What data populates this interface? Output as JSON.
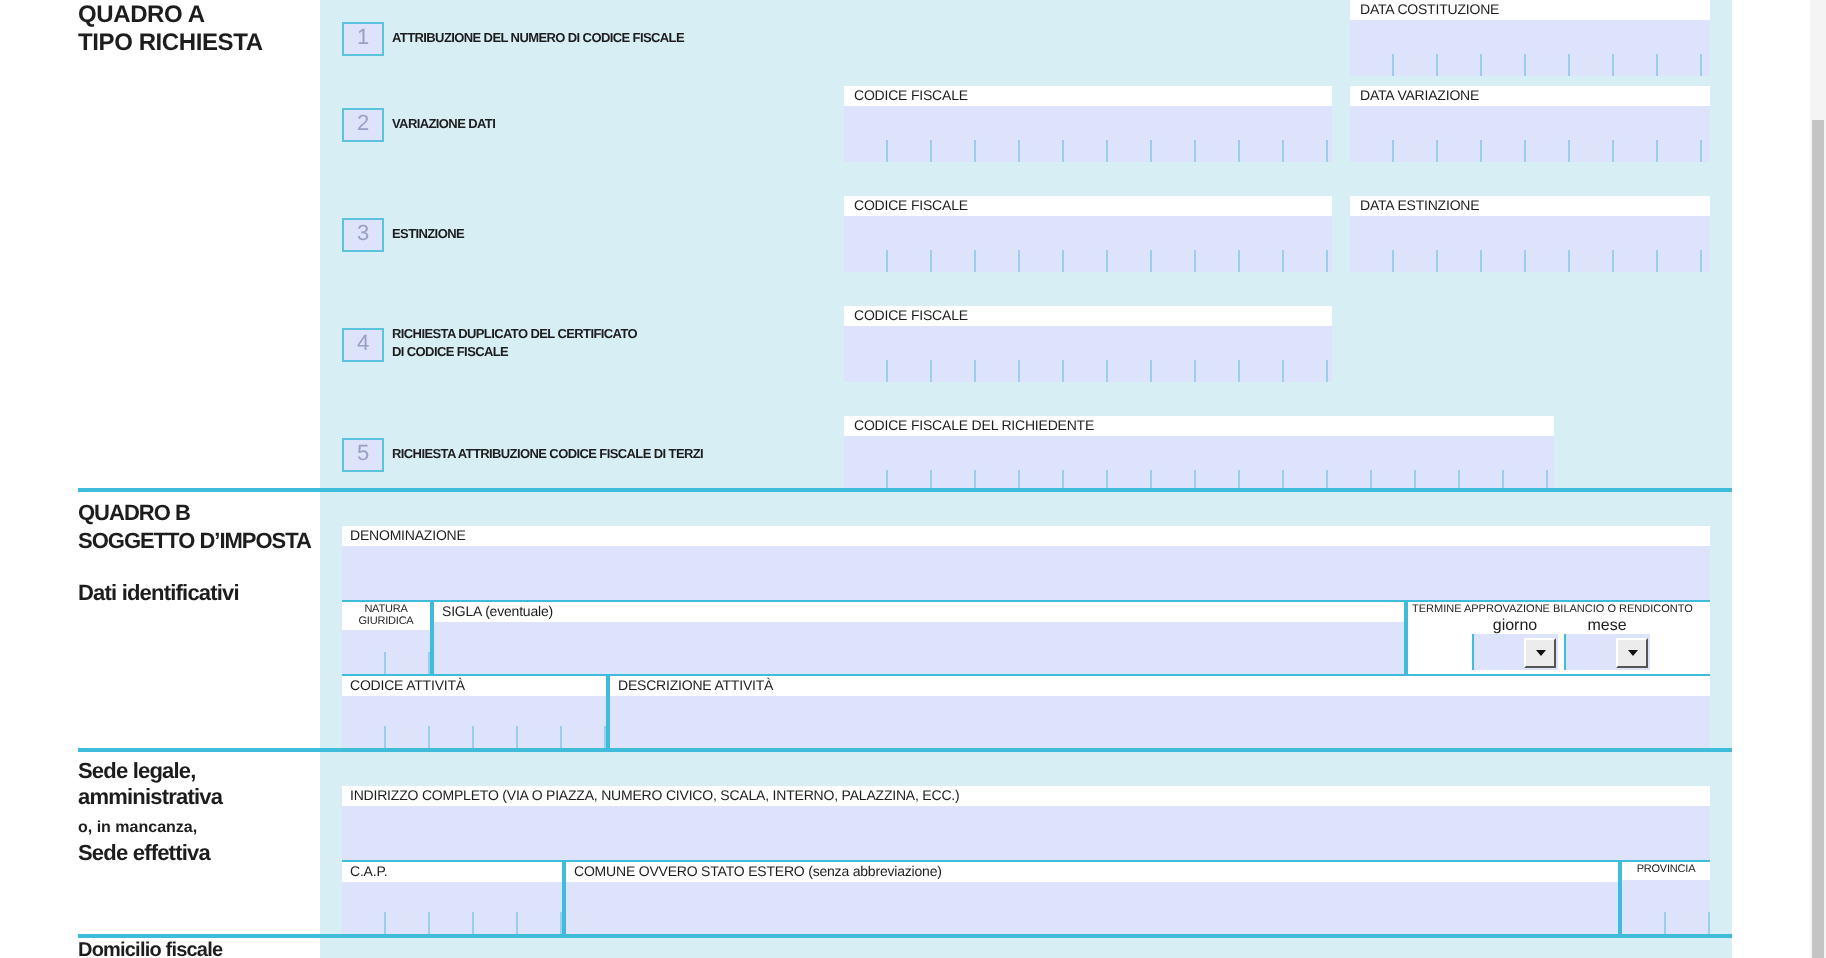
{
  "quadro_a": {
    "title": "QUADRO A",
    "subtitle": "TIPO RICHIESTA",
    "requests": [
      {
        "number": "1",
        "label": "ATTRIBUZIONE DEL NUMERO DI CODICE FISCALE",
        "date_field": {
          "label": "DATA COSTITUZIONE",
          "kind": "date"
        }
      },
      {
        "number": "2",
        "label": "VARIAZIONE DATI",
        "code_field": {
          "label": "CODICE FISCALE",
          "kind": "code"
        },
        "date_field": {
          "label": "DATA VARIAZIONE",
          "kind": "date"
        }
      },
      {
        "number": "3",
        "label": "ESTINZIONE",
        "code_field": {
          "label": "CODICE FISCALE",
          "kind": "code"
        },
        "date_field": {
          "label": "DATA ESTINZIONE",
          "kind": "date"
        }
      },
      {
        "number": "4",
        "label": "RICHIESTA DUPLICATO DEL CERTIFICATO\nDI CODICE FISCALE",
        "code_field": {
          "label": "CODICE FISCALE",
          "kind": "code"
        }
      },
      {
        "number": "5",
        "label": "RICHIESTA ATTRIBUZIONE CODICE FISCALE DI TERZI",
        "code_field": {
          "label": "CODICE FISCALE DEL RICHIEDENTE",
          "kind": "long_code"
        }
      }
    ]
  },
  "quadro_b": {
    "title": "QUADRO B",
    "subtitle": "SOGGETTO D’IMPOSTA",
    "groups": [
      {
        "captions": [
          {
            "text": "Dati identificativi",
            "kind": "major"
          }
        ],
        "rows": [
          [
            {
              "label": "DENOMINAZIONE",
              "kind": "text"
            }
          ],
          [
            {
              "label": "NATURA\nGIURIDICA",
              "kind": "comb2"
            },
            {
              "label": "SIGLA (eventuale)",
              "kind": "text"
            },
            {
              "label": "TERMINE APPROVAZIONE BILANCIO O RENDICONTO",
              "kind": "deadline",
              "selects": [
                {
                  "label": "giorno"
                },
                {
                  "label": "mese"
                }
              ]
            }
          ],
          [
            {
              "label": "CODICE ATTIVITÀ",
              "kind": "comb6"
            },
            {
              "label": "DESCRIZIONE ATTIVITÀ",
              "kind": "text"
            }
          ]
        ]
      },
      {
        "captions": [
          {
            "text": "Sede legale,",
            "kind": "major"
          },
          {
            "text": "amministrativa",
            "kind": "major"
          },
          {
            "text": "o, in mancanza,",
            "kind": "minor"
          },
          {
            "text": "Sede effettiva",
            "kind": "major"
          }
        ],
        "rows": [
          [
            {
              "label": "INDIRIZZO COMPLETO (VIA O PIAZZA, NUMERO CIVICO, SCALA, INTERNO, PALAZZINA, ECC.)",
              "kind": "text"
            }
          ],
          [
            {
              "label": "C.A.P.",
              "kind": "comb5"
            },
            {
              "label": "COMUNE OVVERO STATO ESTERO (senza abbreviazione)",
              "kind": "text"
            },
            {
              "label": "PROVINCIA",
              "kind": "comb2"
            }
          ]
        ]
      },
      {
        "captions": [
          {
            "text": "Domicilio fiscale",
            "kind": "major"
          }
        ]
      }
    ]
  }
}
